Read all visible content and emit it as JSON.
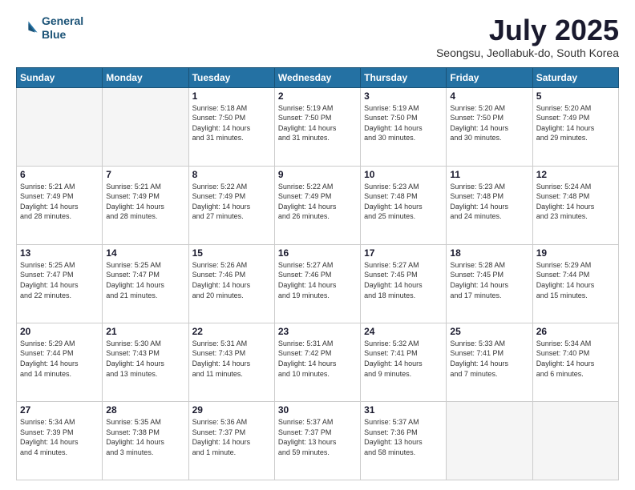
{
  "header": {
    "logo": {
      "line1": "General",
      "line2": "Blue"
    },
    "title": "July 2025",
    "subtitle": "Seongsu, Jeollabuk-do, South Korea"
  },
  "calendar": {
    "days_of_week": [
      "Sunday",
      "Monday",
      "Tuesday",
      "Wednesday",
      "Thursday",
      "Friday",
      "Saturday"
    ],
    "weeks": [
      [
        {
          "day": "",
          "info": ""
        },
        {
          "day": "",
          "info": ""
        },
        {
          "day": "1",
          "info": "Sunrise: 5:18 AM\nSunset: 7:50 PM\nDaylight: 14 hours\nand 31 minutes."
        },
        {
          "day": "2",
          "info": "Sunrise: 5:19 AM\nSunset: 7:50 PM\nDaylight: 14 hours\nand 31 minutes."
        },
        {
          "day": "3",
          "info": "Sunrise: 5:19 AM\nSunset: 7:50 PM\nDaylight: 14 hours\nand 30 minutes."
        },
        {
          "day": "4",
          "info": "Sunrise: 5:20 AM\nSunset: 7:50 PM\nDaylight: 14 hours\nand 30 minutes."
        },
        {
          "day": "5",
          "info": "Sunrise: 5:20 AM\nSunset: 7:49 PM\nDaylight: 14 hours\nand 29 minutes."
        }
      ],
      [
        {
          "day": "6",
          "info": "Sunrise: 5:21 AM\nSunset: 7:49 PM\nDaylight: 14 hours\nand 28 minutes."
        },
        {
          "day": "7",
          "info": "Sunrise: 5:21 AM\nSunset: 7:49 PM\nDaylight: 14 hours\nand 28 minutes."
        },
        {
          "day": "8",
          "info": "Sunrise: 5:22 AM\nSunset: 7:49 PM\nDaylight: 14 hours\nand 27 minutes."
        },
        {
          "day": "9",
          "info": "Sunrise: 5:22 AM\nSunset: 7:49 PM\nDaylight: 14 hours\nand 26 minutes."
        },
        {
          "day": "10",
          "info": "Sunrise: 5:23 AM\nSunset: 7:48 PM\nDaylight: 14 hours\nand 25 minutes."
        },
        {
          "day": "11",
          "info": "Sunrise: 5:23 AM\nSunset: 7:48 PM\nDaylight: 14 hours\nand 24 minutes."
        },
        {
          "day": "12",
          "info": "Sunrise: 5:24 AM\nSunset: 7:48 PM\nDaylight: 14 hours\nand 23 minutes."
        }
      ],
      [
        {
          "day": "13",
          "info": "Sunrise: 5:25 AM\nSunset: 7:47 PM\nDaylight: 14 hours\nand 22 minutes."
        },
        {
          "day": "14",
          "info": "Sunrise: 5:25 AM\nSunset: 7:47 PM\nDaylight: 14 hours\nand 21 minutes."
        },
        {
          "day": "15",
          "info": "Sunrise: 5:26 AM\nSunset: 7:46 PM\nDaylight: 14 hours\nand 20 minutes."
        },
        {
          "day": "16",
          "info": "Sunrise: 5:27 AM\nSunset: 7:46 PM\nDaylight: 14 hours\nand 19 minutes."
        },
        {
          "day": "17",
          "info": "Sunrise: 5:27 AM\nSunset: 7:45 PM\nDaylight: 14 hours\nand 18 minutes."
        },
        {
          "day": "18",
          "info": "Sunrise: 5:28 AM\nSunset: 7:45 PM\nDaylight: 14 hours\nand 17 minutes."
        },
        {
          "day": "19",
          "info": "Sunrise: 5:29 AM\nSunset: 7:44 PM\nDaylight: 14 hours\nand 15 minutes."
        }
      ],
      [
        {
          "day": "20",
          "info": "Sunrise: 5:29 AM\nSunset: 7:44 PM\nDaylight: 14 hours\nand 14 minutes."
        },
        {
          "day": "21",
          "info": "Sunrise: 5:30 AM\nSunset: 7:43 PM\nDaylight: 14 hours\nand 13 minutes."
        },
        {
          "day": "22",
          "info": "Sunrise: 5:31 AM\nSunset: 7:43 PM\nDaylight: 14 hours\nand 11 minutes."
        },
        {
          "day": "23",
          "info": "Sunrise: 5:31 AM\nSunset: 7:42 PM\nDaylight: 14 hours\nand 10 minutes."
        },
        {
          "day": "24",
          "info": "Sunrise: 5:32 AM\nSunset: 7:41 PM\nDaylight: 14 hours\nand 9 minutes."
        },
        {
          "day": "25",
          "info": "Sunrise: 5:33 AM\nSunset: 7:41 PM\nDaylight: 14 hours\nand 7 minutes."
        },
        {
          "day": "26",
          "info": "Sunrise: 5:34 AM\nSunset: 7:40 PM\nDaylight: 14 hours\nand 6 minutes."
        }
      ],
      [
        {
          "day": "27",
          "info": "Sunrise: 5:34 AM\nSunset: 7:39 PM\nDaylight: 14 hours\nand 4 minutes."
        },
        {
          "day": "28",
          "info": "Sunrise: 5:35 AM\nSunset: 7:38 PM\nDaylight: 14 hours\nand 3 minutes."
        },
        {
          "day": "29",
          "info": "Sunrise: 5:36 AM\nSunset: 7:37 PM\nDaylight: 14 hours\nand 1 minute."
        },
        {
          "day": "30",
          "info": "Sunrise: 5:37 AM\nSunset: 7:37 PM\nDaylight: 13 hours\nand 59 minutes."
        },
        {
          "day": "31",
          "info": "Sunrise: 5:37 AM\nSunset: 7:36 PM\nDaylight: 13 hours\nand 58 minutes."
        },
        {
          "day": "",
          "info": ""
        },
        {
          "day": "",
          "info": ""
        }
      ]
    ]
  }
}
